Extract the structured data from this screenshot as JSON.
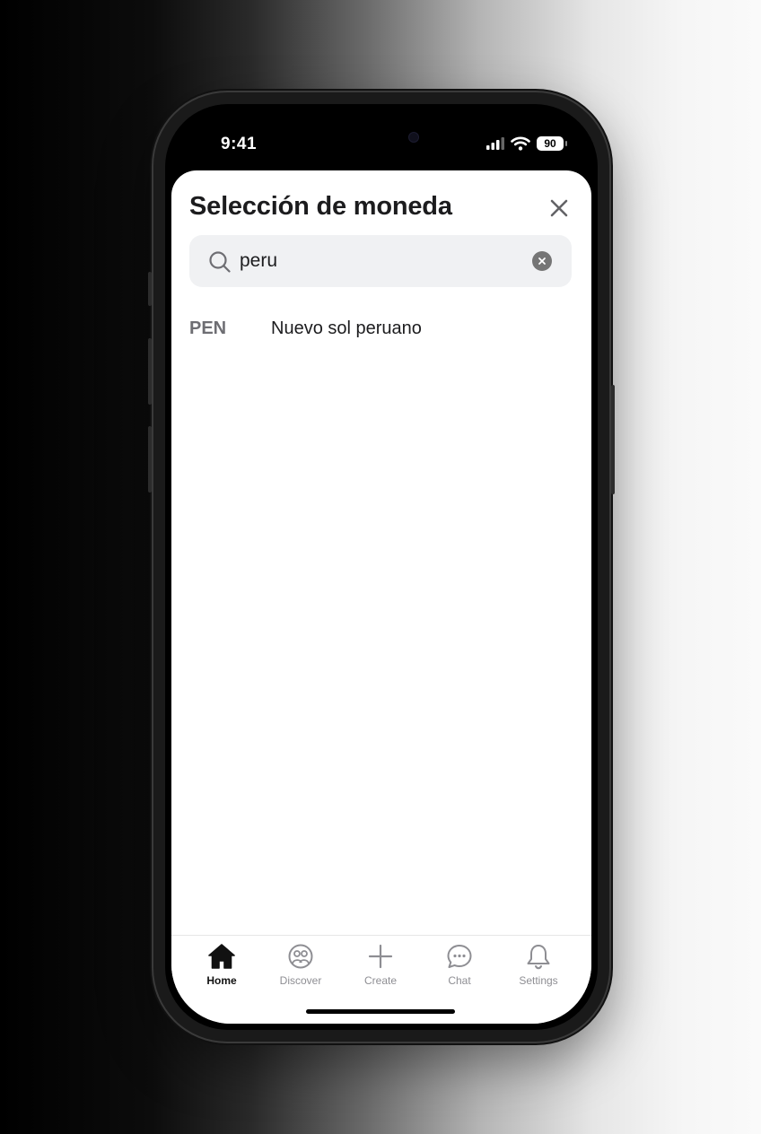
{
  "status_bar": {
    "time": "9:41",
    "battery": "90"
  },
  "sheet": {
    "title": "Selección de moneda",
    "search": {
      "value": "peru"
    }
  },
  "results": [
    {
      "code": "PEN",
      "name": "Nuevo sol peruano"
    }
  ],
  "tabs": [
    {
      "label": "Home",
      "icon": "home-icon",
      "active": true
    },
    {
      "label": "Discover",
      "icon": "discover-icon"
    },
    {
      "label": "Create",
      "icon": "plus-icon"
    },
    {
      "label": "Chat",
      "icon": "chat-icon"
    },
    {
      "label": "Settings",
      "icon": "bell-icon"
    }
  ],
  "colors": {
    "active_tab": "#111111",
    "inactive_tab": "#8e8e93",
    "search_bg": "#f0f1f3"
  }
}
